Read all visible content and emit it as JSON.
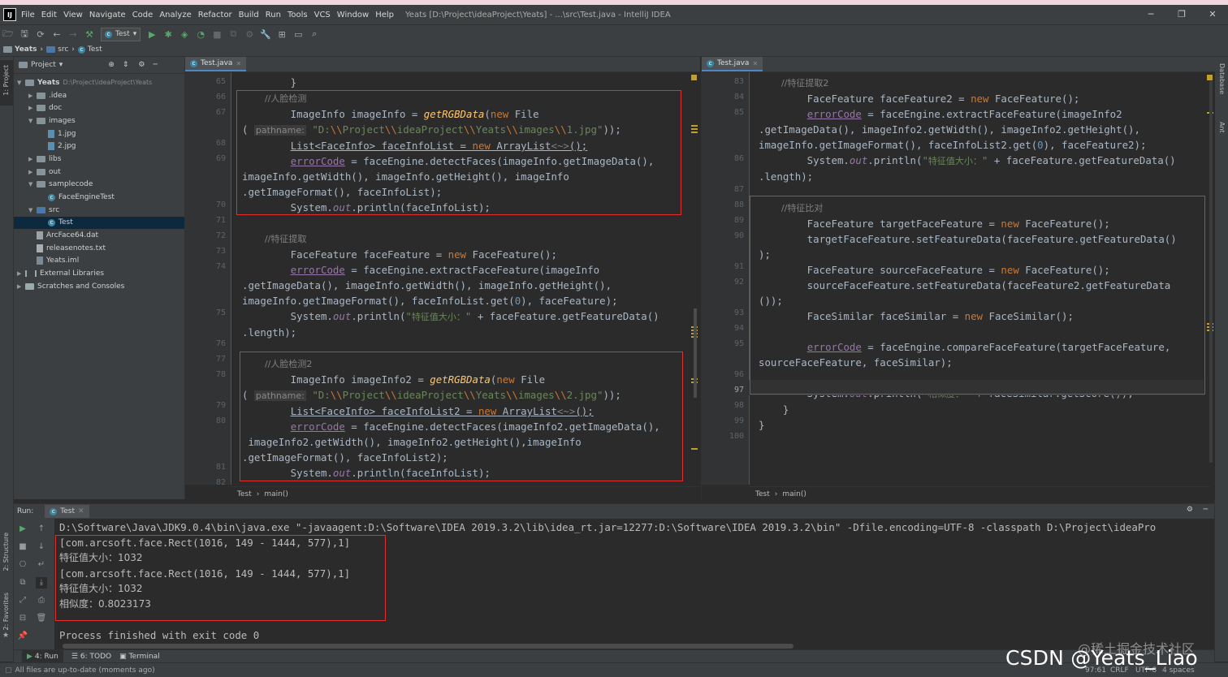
{
  "window": {
    "title": "Yeats [D:\\Project\\ideaProject\\Yeats] - ...\\src\\Test.java - IntelliJ IDEA",
    "logo": "IJ",
    "menu": [
      "File",
      "Edit",
      "View",
      "Navigate",
      "Code",
      "Analyze",
      "Refactor",
      "Build",
      "Run",
      "Tools",
      "VCS",
      "Window",
      "Help"
    ]
  },
  "toolbar": {
    "run_config": "Test"
  },
  "navbar": {
    "items": [
      "Yeats",
      "src",
      "Test"
    ]
  },
  "left_strip": {
    "project": "1: Project",
    "structure": "2: Structure",
    "favorites": "2: Favorites"
  },
  "right_strip": {
    "database": "Database",
    "ant": "Ant"
  },
  "project": {
    "header": "Project",
    "tree": [
      {
        "name": "Yeats",
        "path": "D:\\Project\\ideaProject\\Yeats",
        "depth": 0,
        "kind": "folder",
        "open": true
      },
      {
        "name": ".idea",
        "depth": 1,
        "kind": "folder",
        "open": false
      },
      {
        "name": "doc",
        "depth": 1,
        "kind": "folder",
        "open": false
      },
      {
        "name": "images",
        "depth": 1,
        "kind": "folder",
        "open": true
      },
      {
        "name": "1.jpg",
        "depth": 2,
        "kind": "jpg"
      },
      {
        "name": "2.jpg",
        "depth": 2,
        "kind": "jpg"
      },
      {
        "name": "libs",
        "depth": 1,
        "kind": "folder",
        "open": false
      },
      {
        "name": "out",
        "depth": 1,
        "kind": "folder",
        "open": false
      },
      {
        "name": "samplecode",
        "depth": 1,
        "kind": "folder",
        "open": true
      },
      {
        "name": "FaceEngineTest",
        "depth": 2,
        "kind": "class"
      },
      {
        "name": "src",
        "depth": 1,
        "kind": "folder",
        "open": true
      },
      {
        "name": "Test",
        "depth": 2,
        "kind": "class",
        "selected": true
      },
      {
        "name": "ArcFace64.dat",
        "depth": 1,
        "kind": "dat"
      },
      {
        "name": "releasenotes.txt",
        "depth": 1,
        "kind": "txt"
      },
      {
        "name": "Yeats.iml",
        "depth": 1,
        "kind": "iml"
      },
      {
        "name": "External Libraries",
        "depth": 0,
        "kind": "libs",
        "open": false
      },
      {
        "name": "Scratches and Consoles",
        "depth": 0,
        "kind": "scratch",
        "open": false
      }
    ]
  },
  "editor_left": {
    "tab": "Test.java",
    "breadcrumb": [
      "Test",
      "main()"
    ],
    "line_numbers": [
      "65",
      "66",
      "67",
      "",
      "68",
      "69",
      "",
      "",
      "70",
      "71",
      "72",
      "73",
      "74",
      "",
      "",
      "75",
      "",
      "76",
      "77",
      "78",
      "",
      "79",
      "80",
      "",
      "",
      "81",
      "82"
    ]
  },
  "editor_right": {
    "tab": "Test.java",
    "breadcrumb": [
      "Test",
      "main()"
    ],
    "line_numbers": [
      "83",
      "84",
      "85",
      "",
      "",
      "86",
      "",
      "87",
      "88",
      "89",
      "90",
      "",
      "91",
      "92",
      "",
      "93",
      "94",
      "95",
      "",
      "96",
      "97",
      "98",
      "99",
      "100"
    ]
  },
  "run": {
    "label": "Run:",
    "tab": "Test",
    "output": [
      "D:\\Software\\Java\\JDK9.0.4\\bin\\java.exe \"-javaagent:D:\\Software\\IDEA 2019.3.2\\lib\\idea_rt.jar=12277:D:\\Software\\IDEA 2019.3.2\\bin\" -Dfile.encoding=UTF-8 -classpath D:\\Project\\ideaPro",
      "[com.arcsoft.face.Rect(1016, 149 - 1444, 577),1]",
      "特征值大小：1032",
      "[com.arcsoft.face.Rect(1016, 149 - 1444, 577),1]",
      "特征值大小：1032",
      "相似度：0.8023173",
      "",
      "Process finished with exit code 0"
    ]
  },
  "bottom_tabs": [
    "4: Run",
    "6: TODO",
    "Terminal"
  ],
  "status": {
    "message": "All files are up-to-date (moments ago)",
    "position": "97:61",
    "line_sep": "CRLF",
    "encoding": "UTF-8",
    "indent": "4 spaces"
  },
  "watermark": {
    "csdn": "CSDN @Yeats_Liao",
    "juejin": "@稀土掘金技术社区"
  }
}
